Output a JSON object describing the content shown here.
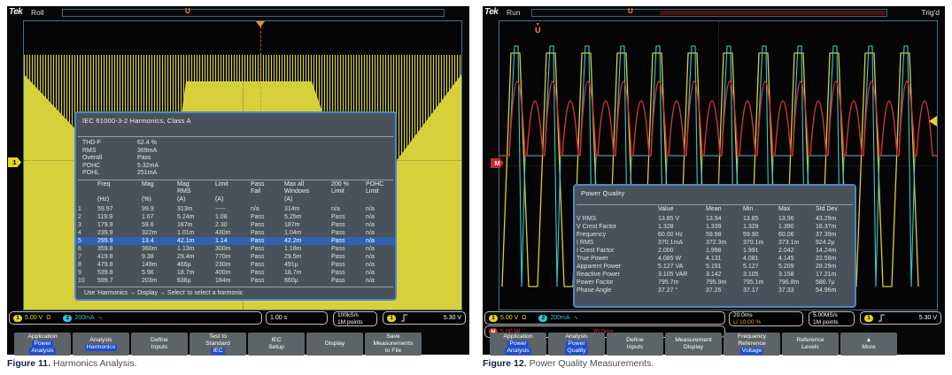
{
  "icons": {
    "holdoff": "⊔",
    "sine": "∿",
    "trig_pos_arrow": "▼",
    "trig_pos_u": "U"
  },
  "badges": {
    "ch1": "1",
    "ch2": "2",
    "math": "M"
  },
  "left": {
    "brand": "Tek",
    "mode": "Roll",
    "dialog": {
      "title": "IEC 61000-3-2 Harmonics, Class A",
      "summary": [
        [
          "THD-F",
          "62.4 %"
        ],
        [
          "RMS",
          "369mA"
        ],
        [
          "Overall",
          "Pass"
        ],
        [
          "POHC",
          "5.32mA"
        ],
        [
          "POHL",
          "251mA"
        ]
      ],
      "columns": [
        "",
        "Freq\n \n(Hz)",
        "Mag\n \n(%)",
        "Mag\nRMS\n(A)",
        "Limit\n \n(A)",
        "Pass\nFail",
        "Max all\nWindows\n(A)",
        "200 %\nLimit",
        "POHC\nLimit"
      ],
      "rows": [
        [
          "1",
          "59.97",
          "99.9",
          "313m",
          "-----",
          "n/a",
          "314m",
          "n/a",
          "n/a"
        ],
        [
          "2",
          "119.9",
          "1.67",
          "5.24m",
          "1.08",
          "Pass",
          "5.25m",
          "Pass",
          "n/a"
        ],
        [
          "3",
          "179.9",
          "59.6",
          "187m",
          "2.30",
          "Pass",
          "187m",
          "Pass",
          "n/a"
        ],
        [
          "4",
          "239.9",
          "322m",
          "1.01m",
          "430m",
          "Pass",
          "1.04m",
          "Pass",
          "n/a"
        ],
        [
          "5",
          "299.9",
          "13.4",
          "42.1m",
          "1.14",
          "Pass",
          "42.2m",
          "Pass",
          "n/a"
        ],
        [
          "6",
          "359.8",
          "360m",
          "1.13m",
          "300m",
          "Pass",
          "1.18m",
          "Pass",
          "n/a"
        ],
        [
          "7",
          "419.8",
          "9.38",
          "29.4m",
          "770m",
          "Pass",
          "29.5m",
          "Pass",
          "n/a"
        ],
        [
          "8",
          "479.8",
          "149m",
          "466µ",
          "230m",
          "Pass",
          "491µ",
          "Pass",
          "n/a"
        ],
        [
          "9",
          "539.8",
          "5.96",
          "18.7m",
          "400m",
          "Pass",
          "18.7m",
          "Pass",
          "n/a"
        ],
        [
          "10",
          "599.7",
          "203m",
          "636µ",
          "184m",
          "Pass",
          "660µ",
          "Pass",
          "n/a"
        ]
      ],
      "highlight_row": 4,
      "hint": "Use 'Harmonics → Display → Select' to select a harmonic"
    },
    "status": {
      "ch1": "5.00 V",
      "ch1_unit": "Ω",
      "ch2": "200mA",
      "time": "1.00 s",
      "rate": "100kS/s",
      "points": "1M points",
      "trig": "5.30 V"
    },
    "menu": [
      [
        [
          "Application",
          0
        ],
        [
          "Power",
          1
        ],
        [
          "Analysis",
          1
        ]
      ],
      [
        [
          "Analysis",
          0
        ],
        [
          "Harmonics",
          1
        ]
      ],
      [
        [
          "Define",
          0
        ],
        [
          "Inputs",
          0
        ]
      ],
      [
        [
          "Test to",
          0
        ],
        [
          "Standard",
          0
        ],
        [
          "IEC",
          1
        ]
      ],
      [
        [
          "IEC",
          0
        ],
        [
          "Setup",
          0
        ]
      ],
      [
        [
          "Display",
          0
        ]
      ],
      [
        [
          "Save",
          0
        ],
        [
          "Measurements",
          0
        ],
        [
          "to File",
          0
        ]
      ]
    ],
    "caption_bold": "Figure 11.",
    "caption_text": "Harmonics Analysis."
  },
  "right": {
    "brand": "Tek",
    "mode": "Run",
    "trig_status": "Trig'd",
    "dialog": {
      "title": "Power Quality",
      "columns": [
        "",
        "Value",
        "Mean",
        "Min",
        "Max",
        "Std Dev"
      ],
      "rows": [
        [
          "V RMS",
          "13.85 V",
          "13.94",
          "13.85",
          "13.96",
          "43.29m"
        ],
        [
          "V Crest Factor",
          "1.328",
          "1.339",
          "1.328",
          "1.390",
          "16.37m"
        ],
        [
          "Frequency",
          "60.00 Hz",
          "59.98",
          "59.90",
          "60.06",
          "37.39m"
        ],
        [
          "I RMS",
          "370.1mA",
          "372.3m",
          "370.1m",
          "373.1m",
          "924.2µ"
        ],
        [
          "I Crest Factor",
          "2.000",
          "1.998",
          "1.991",
          "2.042",
          "14.24m"
        ],
        [
          "True Power",
          "4.085 W",
          "4.131",
          "4.081",
          "4.145",
          "22.59m"
        ],
        [
          "Apparent Power",
          "5.127 VA",
          "5.191",
          "5.127",
          "5.209",
          "28.29m"
        ],
        [
          "Reactive Power",
          "3.105 VAR",
          "3.142",
          "3.105",
          "3.158",
          "17.21m"
        ],
        [
          "Power Factor",
          "795.7m",
          "795.9m",
          "795.1m",
          "796.8m",
          "580.7µ"
        ],
        [
          "Phase Angle",
          "37.27 °",
          "37.26",
          "37.17",
          "37.33",
          "54.96m"
        ]
      ]
    },
    "status": {
      "ch1": "5.00 V",
      "ch1_unit": "Ω",
      "ch2": "200mA",
      "math": "5.00 W",
      "math_time": "20.0ms",
      "time": "20.0ms",
      "holdoff": "10.00 %",
      "rate": "5.00MS/s",
      "points": "1M points",
      "trig": "5.30 V"
    },
    "menu": [
      [
        [
          "Application",
          0
        ],
        [
          "Power",
          1
        ],
        [
          "Analysis",
          1
        ]
      ],
      [
        [
          "Analysis",
          0
        ],
        [
          "Power",
          1
        ],
        [
          "Quality",
          1
        ]
      ],
      [
        [
          "Define",
          0
        ],
        [
          "Inputs",
          0
        ]
      ],
      [
        [
          "Measurement",
          0
        ],
        [
          "Display",
          0
        ]
      ],
      [
        [
          "Frequency",
          0
        ],
        [
          "Reference",
          0
        ],
        [
          "Voltage",
          1
        ]
      ],
      [
        [
          "Reference",
          0
        ],
        [
          "Levels",
          0
        ]
      ],
      [
        [
          "▲",
          0
        ],
        [
          "More",
          0
        ]
      ]
    ],
    "caption_bold": "Figure 12.",
    "caption_text": "Power Quality Measurements."
  }
}
